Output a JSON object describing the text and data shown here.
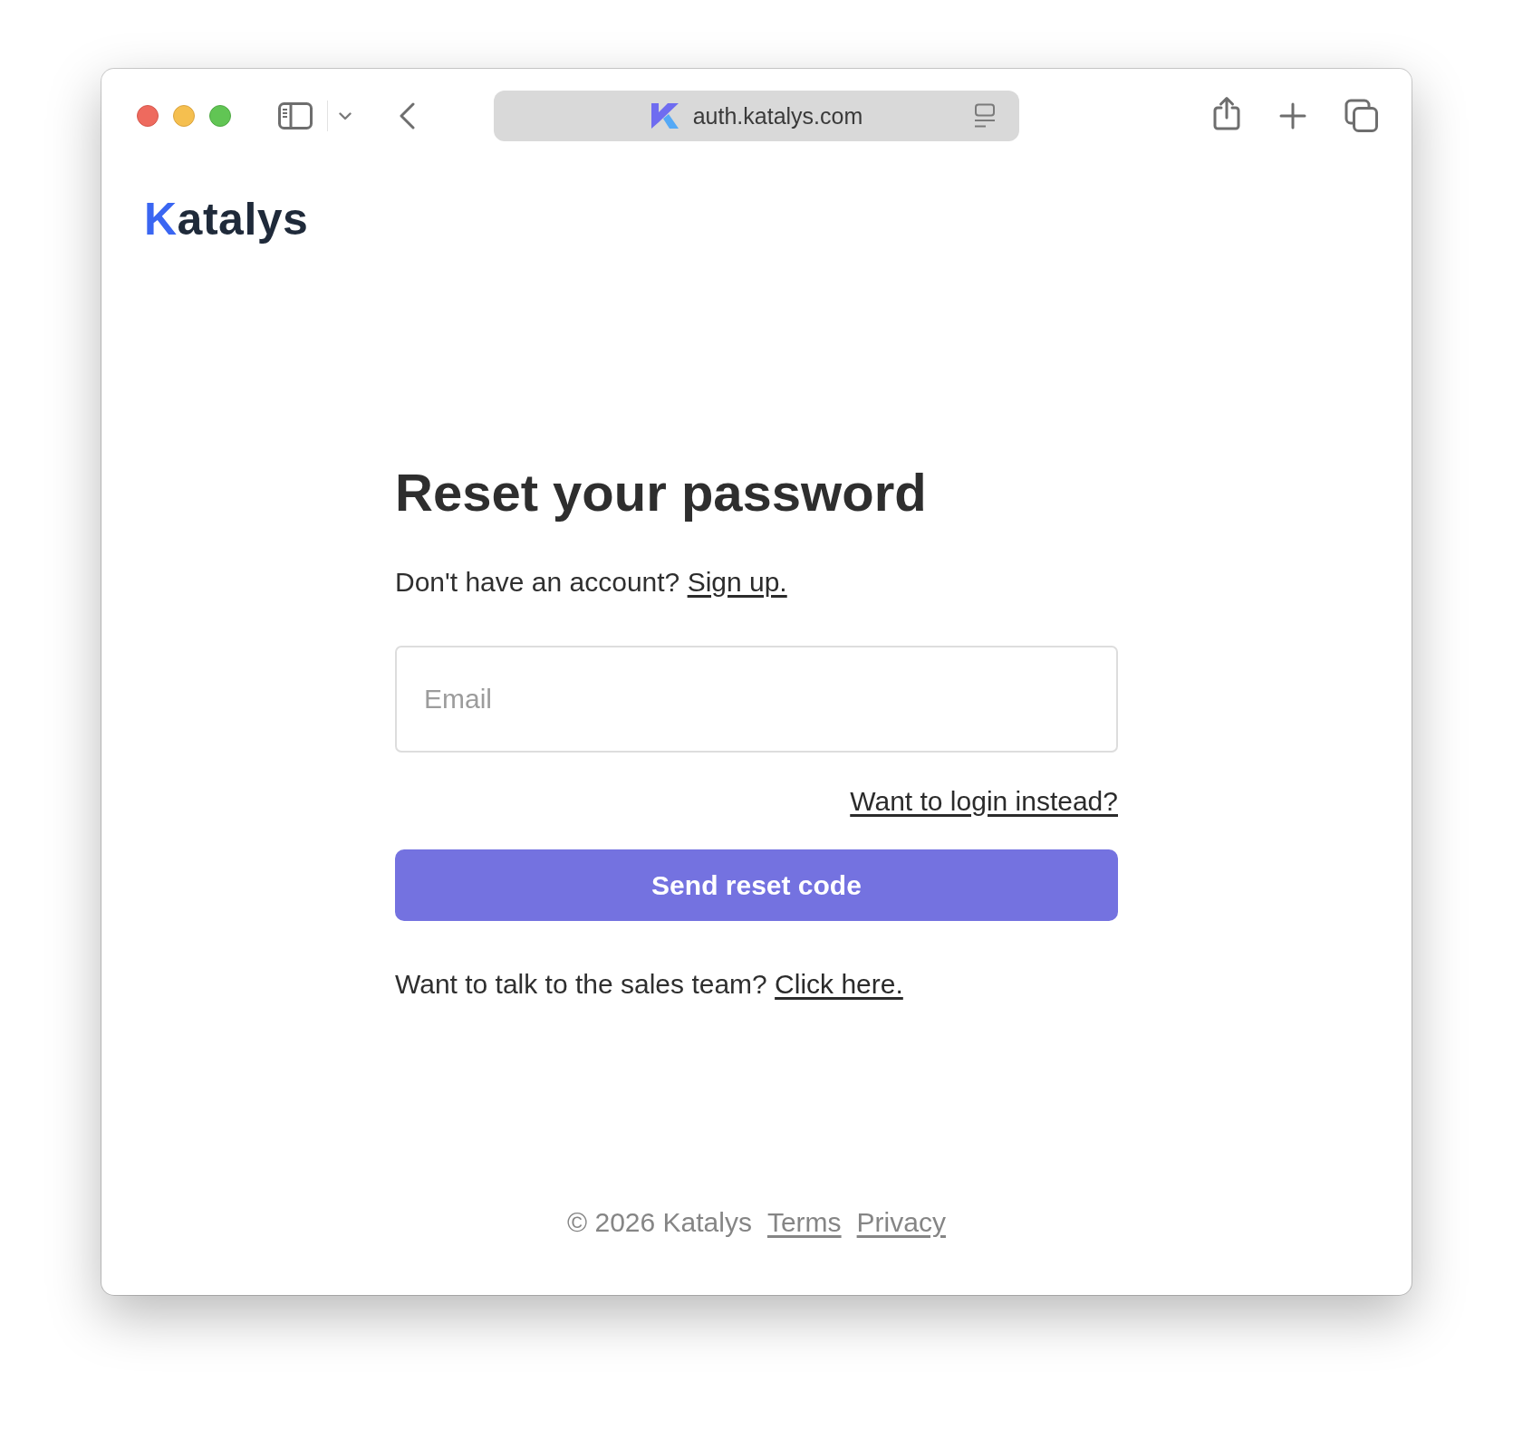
{
  "browser": {
    "url": "auth.katalys.com"
  },
  "logo": {
    "text": "Katalys"
  },
  "form": {
    "title": "Reset your password",
    "signup_prompt": {
      "text": "Don't have an account?",
      "link": "Sign up."
    },
    "email_field": {
      "placeholder": "Email"
    },
    "login_link": "Want to login instead?",
    "submit_button": "Send reset code",
    "sales_prompt": {
      "text": "Want to talk to the sales team?",
      "link": "Click here."
    }
  },
  "footer": {
    "copyright": "© 2026 Katalys",
    "links": [
      "Terms",
      "Privacy"
    ]
  }
}
